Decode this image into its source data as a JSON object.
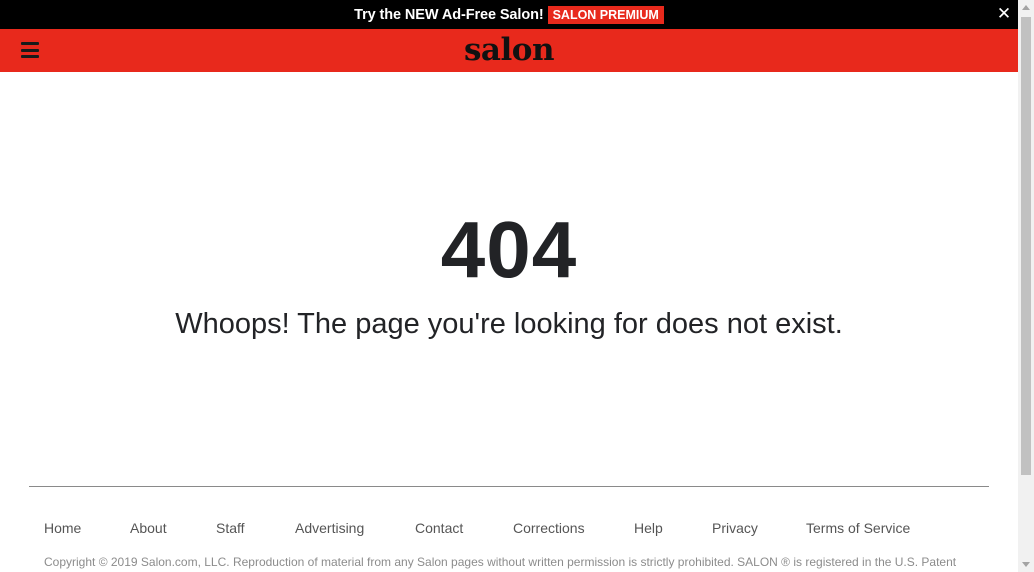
{
  "promo": {
    "text": "Try the NEW Ad-Free Salon!",
    "badge": "SALON PREMIUM",
    "close_glyph": "✕"
  },
  "header": {
    "logo": "salon",
    "menu_icon": "hamburger-menu-icon",
    "background_color": "#e8291c"
  },
  "main": {
    "error_code": "404",
    "error_message": "Whoops! The page you're looking for does not exist."
  },
  "footer": {
    "nav": [
      "Home",
      "About",
      "Staff",
      "Advertising",
      "Contact",
      "Corrections",
      "Help",
      "Privacy",
      "Terms of Service"
    ],
    "copyright": "Copyright © 2019 Salon.com, LLC. Reproduction of material from any Salon pages without written permission is strictly prohibited. SALON ® is registered in the U.S. Patent"
  }
}
